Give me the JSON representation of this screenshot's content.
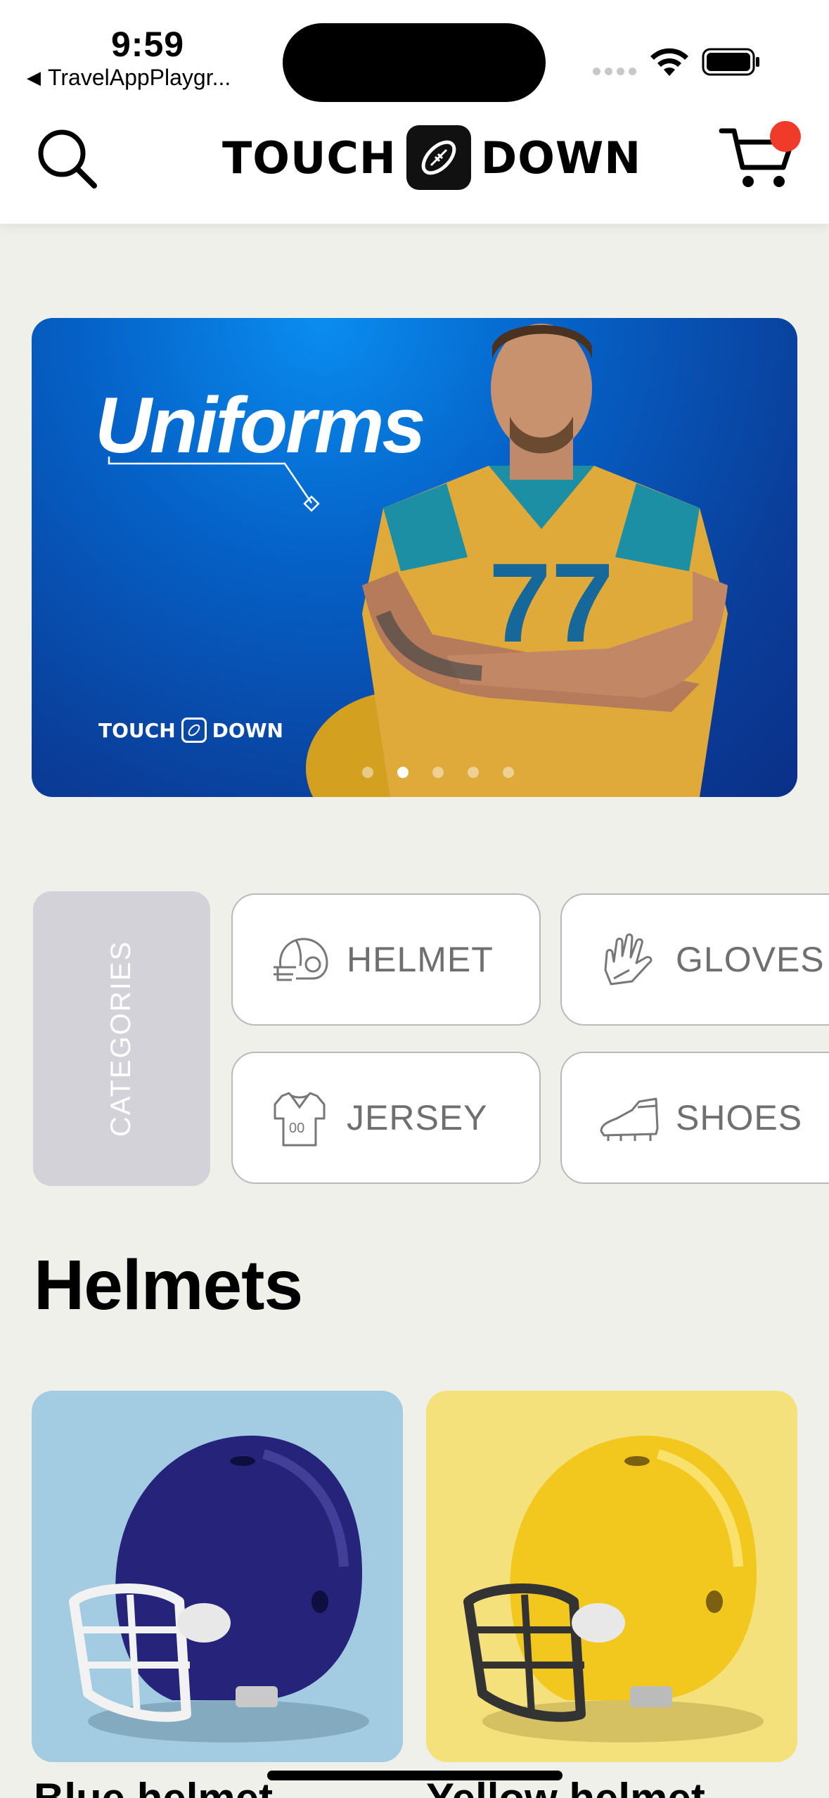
{
  "status_bar": {
    "time": "9:59",
    "back_app": "TravelAppPlaygr..."
  },
  "header": {
    "logo_left": "TOUCH",
    "logo_right": "DOWN",
    "cart_badge_color": "#f03a2a"
  },
  "banner": {
    "title": "Uniforms",
    "logo_left": "TOUCH",
    "logo_right": "DOWN",
    "pages": 5,
    "active_page": 2
  },
  "categories": {
    "label": "CATEGORIES",
    "items": [
      {
        "label": "HELMET",
        "icon": "helmet-icon"
      },
      {
        "label": "GLOVES",
        "icon": "gloves-icon"
      },
      {
        "label": "JERSEY",
        "icon": "jersey-icon"
      },
      {
        "label": "SHOES",
        "icon": "shoes-icon"
      }
    ]
  },
  "section": {
    "title": "Helmets"
  },
  "products": [
    {
      "name": "Blue helmet",
      "bg_color": "#a3cbe2",
      "helmet_color": "#25237a"
    },
    {
      "name": "Yellow helmet",
      "bg_color": "#f4e17c",
      "helmet_color": "#f2c81e"
    }
  ]
}
